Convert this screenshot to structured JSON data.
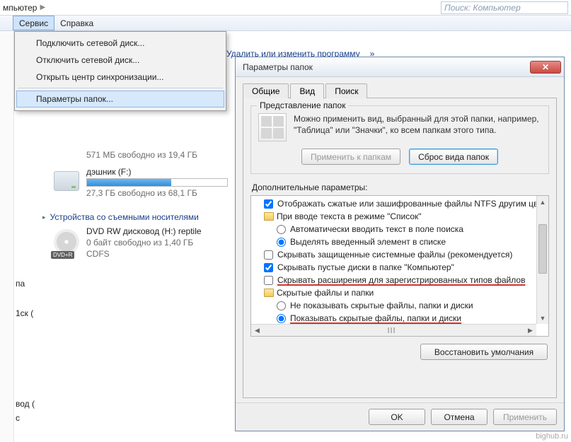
{
  "breadcrumb": {
    "text": "мпьютер"
  },
  "search": {
    "placeholder": "Поиск: Компьютер"
  },
  "menubar": {
    "service": "Сервис",
    "help": "Справка"
  },
  "dropdown": {
    "connect_net_drive": "Подключить сетевой диск...",
    "disconnect_net_drive": "Отключить сетевой диск...",
    "open_sync_center": "Открыть центр синхронизации...",
    "folder_options": "Параметры папок..."
  },
  "toolbar": {
    "uninstall": "Удалить или изменить программу"
  },
  "drives": {
    "d0_sub": "571 МБ свободно из 19,4 ГБ",
    "d1_name": "дэшник (F:)",
    "d1_sub": "27,3 ГБ свободно из 68,1 ГБ",
    "section": "Устройства со съемными носителями",
    "dvd_name": "DVD RW дисковод (H:) reptile",
    "dvd_sub1": "0 байт свободно из 1,40 ГБ",
    "dvd_sub2": "CDFS",
    "dvd_badge": "DVD+R"
  },
  "left_fragments": {
    "f1": "па",
    "f2": "1ск (",
    "f3": "вод (",
    "f4": "с"
  },
  "dialog": {
    "title": "Параметры папок",
    "tabs": {
      "general": "Общие",
      "view": "Вид",
      "search": "Поиск"
    },
    "group_title": "Представление папок",
    "group_text": "Можно применить вид, выбранный для этой папки, например, \"Таблица\" или \"Значки\", ко всем папкам этого типа.",
    "apply_to_folders": "Применить к папкам",
    "reset_folders": "Сброс вида папок",
    "adv_label": "Дополнительные параметры:",
    "tree": {
      "r0": "Отображать сжатые или зашифрованные файлы NTFS другим цветом",
      "r1": "При вводе текста в режиме \"Список\"",
      "r1a": "Автоматически вводить текст в поле поиска",
      "r1b": "Выделять введенный элемент в списке",
      "r2": "Скрывать защищенные системные файлы (рекомендуется)",
      "r3": "Скрывать пустые диски в папке \"Компьютер\"",
      "r4": "Скрывать расширения для зарегистрированных типов файлов",
      "r5": "Скрытые файлы и папки",
      "r5a": "Не показывать скрытые файлы, папки и диски",
      "r5b": "Показывать скрытые файлы, папки и диски"
    },
    "restore_defaults": "Восстановить умолчания",
    "ok": "OK",
    "cancel": "Отмена",
    "apply": "Применить"
  },
  "watermark": "bighub.ru"
}
